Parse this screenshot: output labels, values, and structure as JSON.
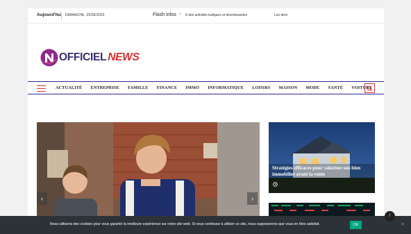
{
  "topbar": {
    "today_label": "Aujourd'hui",
    "date": "DIMANCHE, 25/06/2023",
    "flash_label": "Flash infos",
    "ticker": [
      "6 des activités ludiques et divertissantes",
      "Les dern"
    ]
  },
  "logo": {
    "brand": "OFFICIEL",
    "accent": "NEWS"
  },
  "nav": {
    "items": [
      "ACTUALITÉ",
      "ENTREPRISE",
      "FAMILLE",
      "FINANCE",
      "IMMO",
      "INFORMATIQUE",
      "LOISIRS",
      "MAISON",
      "MODE",
      "SANTÉ",
      "VOITURE"
    ]
  },
  "cards": [
    {
      "title": "Stratégies efficaces pour valoriser son bien immobilier avant la vente"
    }
  ],
  "cookie": {
    "text": "Nous utilisons des cookies pour vous garantir la meilleure expérience sur notre site web. Si vous continuez à utiliser ce site, nous supposerons que vous en êtes satisfait.",
    "ok_label": "OK"
  },
  "colors": {
    "brand_navy": "#2e2a8f",
    "accent_red": "#d32f2f",
    "cookie_bg": "#2c3338",
    "ok_green": "#00a884"
  },
  "icons": [
    "chevron-right-icon",
    "hamburger-icon",
    "search-icon",
    "clock-icon",
    "close-icon",
    "arrow-up-icon",
    "chevron-left-icon"
  ]
}
